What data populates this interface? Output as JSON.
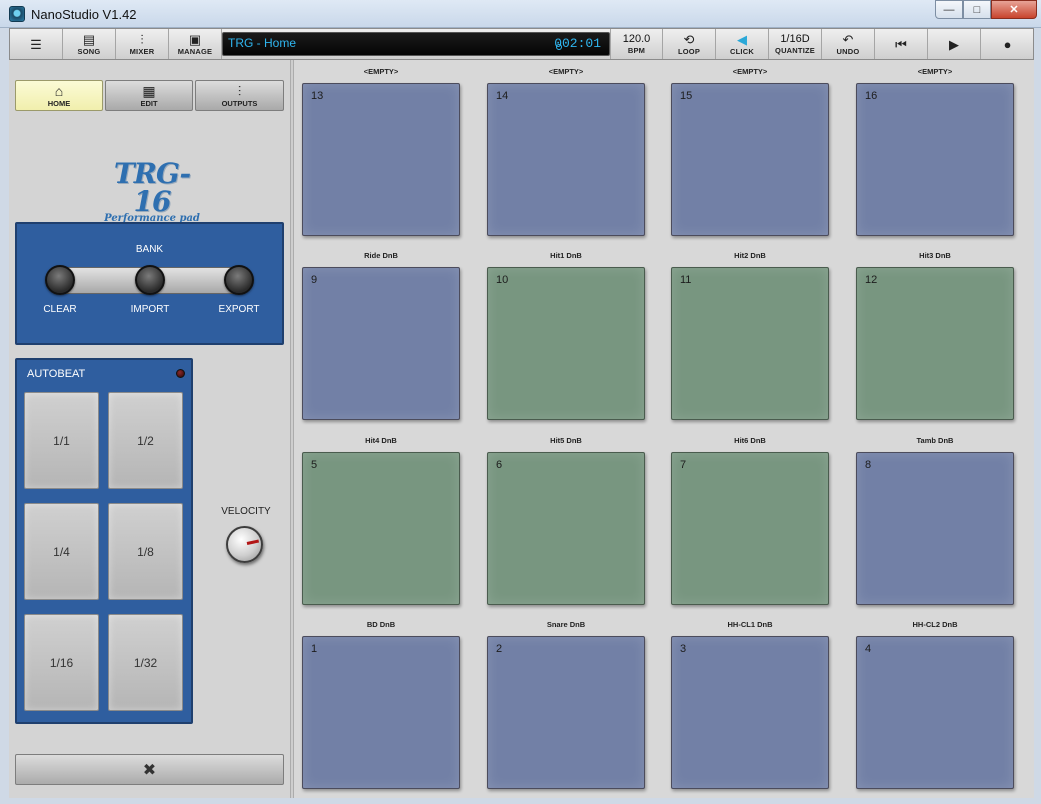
{
  "window": {
    "title": "NanoStudio V1.42",
    "minimize": "—",
    "maximize": "□",
    "close": "✕"
  },
  "toolbar": {
    "menu_icon": "menu-icon",
    "song_label": "SONG",
    "mixer_label": "MIXER",
    "manage_label": "MANAGE",
    "screen_text": "TRG - Home",
    "time": "002:01",
    "bpm_value": "120.0",
    "bpm_label": "BPM",
    "loop_label": "LOOP",
    "click_label": "CLICK",
    "quantize_value": "1/16D",
    "quantize_label": "QUANTIZE",
    "undo_label": "UNDO"
  },
  "nav": {
    "home_label": "HOME",
    "edit_label": "EDIT",
    "outputs_label": "OUTPUTS"
  },
  "logo": {
    "title": "TRG-16",
    "subtitle": "Performance pad"
  },
  "bank": {
    "title": "BANK",
    "clear": "CLEAR",
    "import": "IMPORT",
    "export": "EXPORT"
  },
  "autobeat": {
    "title": "AUTOBEAT",
    "pads": [
      "1/1",
      "1/2",
      "1/4",
      "1/8",
      "1/16",
      "1/32"
    ]
  },
  "velocity": {
    "label": "VELOCITY"
  },
  "pads": [
    {
      "num": "13",
      "label": "<EMPTY>",
      "color": "blue"
    },
    {
      "num": "14",
      "label": "<EMPTY>",
      "color": "blue"
    },
    {
      "num": "15",
      "label": "<EMPTY>",
      "color": "blue"
    },
    {
      "num": "16",
      "label": "<EMPTY>",
      "color": "blue"
    },
    {
      "num": "9",
      "label": "Ride DnB",
      "color": "blue"
    },
    {
      "num": "10",
      "label": "Hit1 DnB",
      "color": "green"
    },
    {
      "num": "11",
      "label": "Hit2 DnB",
      "color": "green"
    },
    {
      "num": "12",
      "label": "Hit3 DnB",
      "color": "green"
    },
    {
      "num": "5",
      "label": "Hit4 DnB",
      "color": "green"
    },
    {
      "num": "6",
      "label": "Hit5 DnB",
      "color": "green"
    },
    {
      "num": "7",
      "label": "Hit6 DnB",
      "color": "green"
    },
    {
      "num": "8",
      "label": "Tamb DnB",
      "color": "blue"
    },
    {
      "num": "1",
      "label": "BD DnB",
      "color": "blue"
    },
    {
      "num": "2",
      "label": "Snare DnB",
      "color": "blue"
    },
    {
      "num": "3",
      "label": "HH-CL1 DnB",
      "color": "blue"
    },
    {
      "num": "4",
      "label": "HH-CL2 DnB",
      "color": "blue"
    }
  ],
  "colors": {
    "pad_blue": "#7280a6",
    "pad_green": "#789680",
    "panel_blue": "#2f5e9f",
    "lcd_text": "#2fb6f0"
  }
}
